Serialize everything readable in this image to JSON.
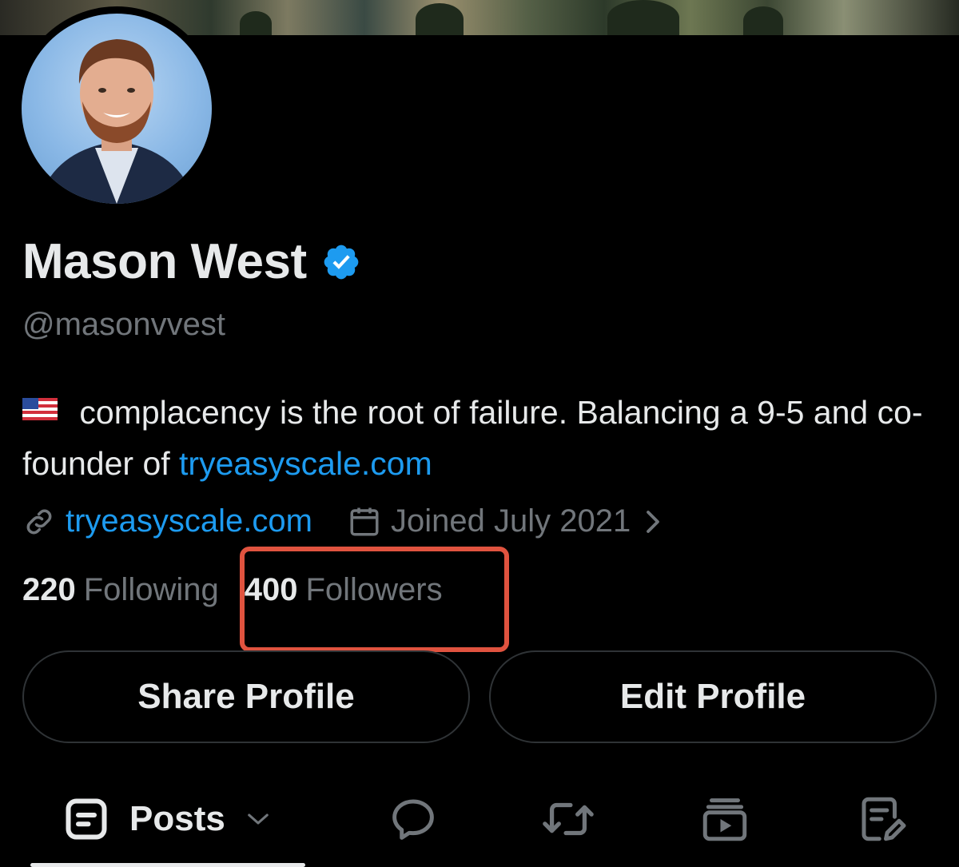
{
  "profile": {
    "name": "Mason West",
    "handle": "@masonvvest",
    "bio_text": " complacency is the root of failure. Balancing a 9-5 and co-founder of ",
    "bio_link": "tryeasyscale.com",
    "website": "tryeasyscale.com",
    "joined": "Joined July 2021"
  },
  "stats": {
    "following_count": "220",
    "following_label": "Following",
    "followers_count": "400",
    "followers_label": "Followers"
  },
  "buttons": {
    "share": "Share Profile",
    "edit": "Edit Profile"
  },
  "tabs": {
    "posts": "Posts"
  },
  "icons": [
    "verified-badge-icon",
    "us-flag-icon",
    "link-icon",
    "calendar-icon",
    "chevron-right-icon",
    "posts-icon",
    "chevron-down-icon",
    "reply-icon",
    "repost-icon",
    "media-icon",
    "articles-icon"
  ],
  "colors": {
    "background": "#000000",
    "text": "#e7e9ea",
    "muted": "#71767b",
    "link": "#1d9bf0",
    "highlight_box": "#e0533f",
    "verified": "#1d9bf0"
  }
}
